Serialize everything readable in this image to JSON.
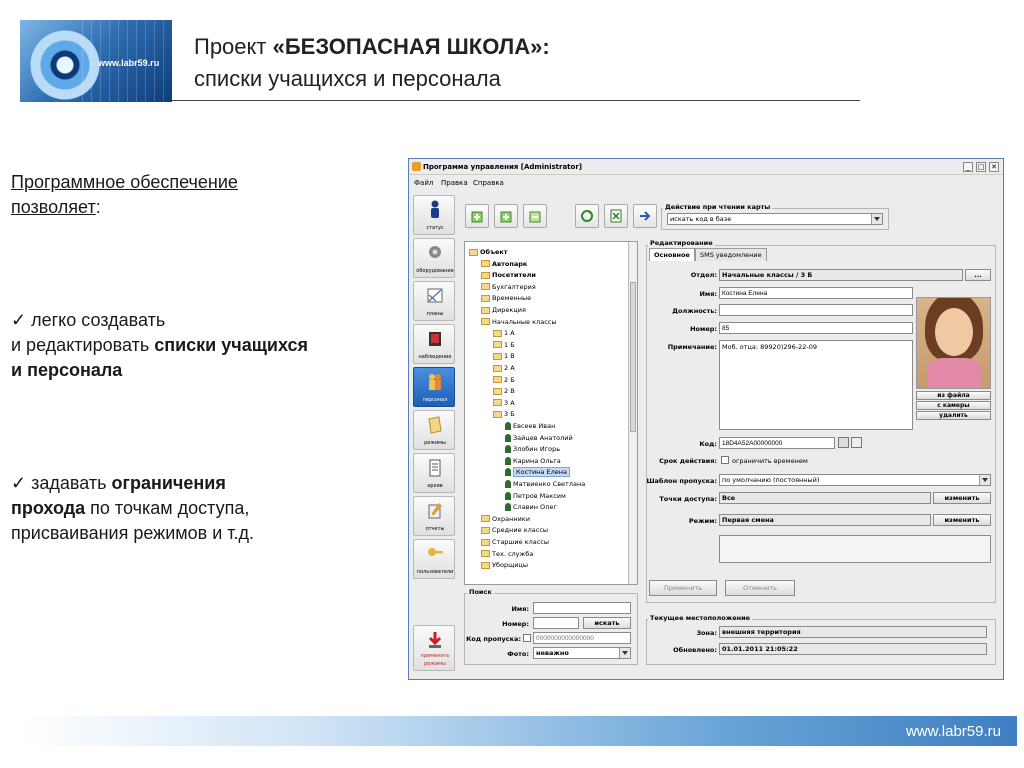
{
  "header": {
    "logo_url_text": "www.labr59.ru",
    "title_prefix": "Проект ",
    "title_bold": "«БЕЗОПАСНАЯ ШКОЛА»:",
    "subtitle": "списки учащихся и персонала"
  },
  "left_text": {
    "intro_line1": "Программное обеспечение",
    "intro_line2": "позволяет",
    "intro_colon": ":",
    "check_mark": "✓",
    "point1_a": " легко создавать",
    "point1_b": "и редактировать ",
    "point1_bold1": "списки учащихся",
    "point1_bold2": "и персонала",
    "point2_a": " задавать ",
    "point2_bold1": "ограничения",
    "point2_bold2": "прохода",
    "point2_b": " по точкам доступа,",
    "point2_c": "присваивания режимов и т.д."
  },
  "footer": {
    "url": "www.labr59.ru"
  },
  "app": {
    "window_title": "Программа управления [Administrator]",
    "menu": [
      "Файл",
      "Правка",
      "Справка"
    ],
    "sidebar": [
      {
        "label": "статус",
        "icon": "status-icon"
      },
      {
        "label": "оборудование",
        "icon": "equipment-icon"
      },
      {
        "label": "планы",
        "icon": "plans-icon"
      },
      {
        "label": "наблюдение",
        "icon": "monitoring-icon"
      },
      {
        "label": "персонал",
        "icon": "personnel-icon",
        "active": true
      },
      {
        "label": "режимы",
        "icon": "modes-icon"
      },
      {
        "label": "архив",
        "icon": "archive-icon"
      },
      {
        "label": "отчеты",
        "icon": "reports-icon"
      },
      {
        "label": "пользователи",
        "icon": "users-icon"
      }
    ],
    "apply_modes_label1": "применить",
    "apply_modes_label2": "режимы",
    "card_action": {
      "group_label": "Действие при чтении карты",
      "value": "искать код в базе"
    },
    "tree": [
      {
        "label": "Объект",
        "level": 0,
        "bold": true,
        "type": "folder"
      },
      {
        "label": "Автопарк",
        "level": 1,
        "bold": true,
        "type": "folder"
      },
      {
        "label": "Посетители",
        "level": 1,
        "bold": true,
        "type": "folder"
      },
      {
        "label": "Бухгалтерия",
        "level": 1,
        "type": "folder"
      },
      {
        "label": "Временные",
        "level": 1,
        "type": "folder"
      },
      {
        "label": "Дирекция",
        "level": 1,
        "type": "folder"
      },
      {
        "label": "Начальные классы",
        "level": 1,
        "type": "folder"
      },
      {
        "label": "1 А",
        "level": 2,
        "type": "folder"
      },
      {
        "label": "1 Б",
        "level": 2,
        "type": "folder"
      },
      {
        "label": "1 В",
        "level": 2,
        "type": "folder"
      },
      {
        "label": "2 А",
        "level": 2,
        "type": "folder"
      },
      {
        "label": "2 Б",
        "level": 2,
        "type": "folder"
      },
      {
        "label": "2 В",
        "level": 2,
        "type": "folder"
      },
      {
        "label": "3 А",
        "level": 2,
        "type": "folder"
      },
      {
        "label": "3 Б",
        "level": 2,
        "type": "folder"
      },
      {
        "label": "Евсеев Иван",
        "level": 3,
        "type": "person"
      },
      {
        "label": "Зайцев Анатолий",
        "level": 3,
        "type": "person"
      },
      {
        "label": "Злобин Игорь",
        "level": 3,
        "type": "person"
      },
      {
        "label": "Карина Ольга",
        "level": 3,
        "type": "person"
      },
      {
        "label": "Костина Елена",
        "level": 3,
        "type": "person",
        "selected": true
      },
      {
        "label": "Матвиенко Светлана",
        "level": 3,
        "type": "person"
      },
      {
        "label": "Петров Максим",
        "level": 3,
        "type": "person"
      },
      {
        "label": "Славин Олег",
        "level": 3,
        "type": "person"
      },
      {
        "label": "Охранники",
        "level": 1,
        "type": "folder"
      },
      {
        "label": "Средние классы",
        "level": 1,
        "type": "folder"
      },
      {
        "label": "Старшие классы",
        "level": 1,
        "type": "folder"
      },
      {
        "label": "Тех. служба",
        "level": 1,
        "type": "folder"
      },
      {
        "label": "Уборщицы",
        "level": 1,
        "type": "folder"
      }
    ],
    "edit": {
      "group_label": "Редактирование",
      "tabs": [
        "Основное",
        "SMS уведомление"
      ],
      "dept_label": "Отдел:",
      "dept_value": "Начальные классы / 3 Б",
      "dept_btn": "...",
      "name_label": "Имя:",
      "name_value": "Костина Елена",
      "position_label": "Должность:",
      "position_value": "",
      "number_label": "Номер:",
      "number_value": "85",
      "note_label": "Примечание:",
      "note_value": "Моб. отца: 89920)296-22-09",
      "photo_from_file": "из файла",
      "photo_from_camera": "с камеры",
      "photo_delete": "удалить",
      "code_label": "Код:",
      "code_value": "18D4A52A00000000",
      "validity_label": "Срок действия:",
      "validity_check": "ограничить временем",
      "template_label": "Шаблон пропуска:",
      "template_value": "по умолчанию (постоянный)",
      "access_label": "Точки доступа:",
      "access_value": "Все",
      "access_btn": "изменить",
      "mode_label": "Режим:",
      "mode_value": "Первая смена",
      "mode_btn": "изменить",
      "apply_btn": "Применить",
      "cancel_btn": "Отменить"
    },
    "search": {
      "group_label": "Поиск",
      "name_label": "Имя:",
      "number_label": "Номер:",
      "search_btn": "искать",
      "code_label": "Код пропуска:",
      "code_placeholder": "0000000000000000",
      "photo_label": "Фото:",
      "photo_value": "неважно"
    },
    "location": {
      "group_label": "Текущее местоположение",
      "zone_label": "Зона:",
      "zone_value": "внешняя территория",
      "updated_label": "Обновлено:",
      "updated_value": "01.01.2011 21:05:22"
    }
  }
}
